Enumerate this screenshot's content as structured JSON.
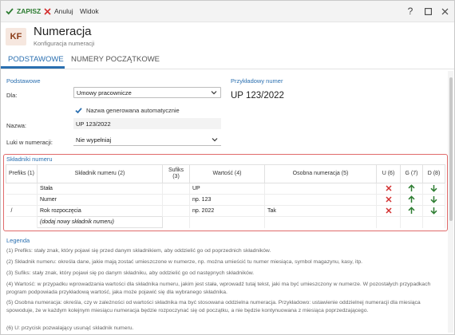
{
  "toolbar": {
    "save_label": "ZAPISZ",
    "cancel_label": "Anuluj",
    "view_label": "Widok",
    "help_label": "?"
  },
  "header": {
    "badge": "KF",
    "title": "Numeracja",
    "subtitle": "Konfiguracja numeracji"
  },
  "tabs": [
    {
      "label": "PODSTAWOWE",
      "active": true
    },
    {
      "label": "NUMERY POCZĄTKOWE",
      "active": false
    }
  ],
  "basic": {
    "section_title": "Podstawowe",
    "dla_label": "Dla:",
    "dla_value": "Umowy pracownicze",
    "auto_name_label": "Nazwa generowana automatycznie",
    "auto_name_checked": true,
    "nazwa_label": "Nazwa:",
    "nazwa_value": "UP 123/2022",
    "luki_label": "Luki w numeracji:",
    "luki_value": "Nie wypełniaj"
  },
  "preview": {
    "label": "Przykładowy numer",
    "value": "UP 123/2022"
  },
  "components": {
    "section_title": "Składniki numeru",
    "columns": [
      "Prefiks (1)",
      "Składnik numeru (2)",
      "Sufiks (3)",
      "Wartość (4)",
      "Osobna numeracja (5)",
      "U (6)",
      "G (7)",
      "D (8)"
    ],
    "rows": [
      {
        "prefix": "",
        "component": "Stała",
        "suffix": "",
        "value": "UP",
        "separate": ""
      },
      {
        "prefix": "",
        "component": "Numer",
        "suffix": "",
        "value": "np. 123",
        "separate": ""
      },
      {
        "prefix": "/",
        "component": "Rok rozpoczęcia",
        "suffix": "",
        "value": "np. 2022",
        "separate": "Tak"
      }
    ],
    "add_placeholder": "(dodaj nowy składnik numeru)"
  },
  "legend": {
    "title": "Legenda",
    "items": [
      "(1) Prefiks: stały znak, który pojawi się przed danym składnikiem, aby oddzielić go od poprzednich składników.",
      "(2) Składnik numeru: określa dane, jakie mają zostać umieszczone w numerze, np. można umieścić tu numer miesiąca, symbol magazynu, kasy, itp.",
      "(3) Sufiks: stały znak, który pojawi się po danym składniku, aby oddzielić go od następnych składników.",
      "(4) Wartość: w przypadku wprowadzania wartości dla składnika numeru, jakim jest stała,  wprowadź tutaj tekst, jaki ma być umieszczony  w numerze. W pozostałych przypadkach program podpowiada przykładową wartość, jaka może pojawić się dla wybranego składnika.",
      "(5) Osobna numeracja: określa, czy w zależności od wartości składnika ma być stosowana oddzielna numeracja. Przykładowo: ustawienie oddzielnej numeracji dla miesiąca spowoduje, że w każdym kolejnym miesiącu numeracja będzie rozpoczynać się od początku, a nie będzie kontynuowana z miesiąca poprzedzającego.",
      "(6) U: przycisk pozwalający usunąć składnik numeru."
    ]
  },
  "colors": {
    "accent": "#2a6fb0",
    "save_green": "#2e7d32",
    "delete_red": "#d32f2f",
    "move_green": "#2e7d32",
    "highlight_border": "#e06a6a"
  }
}
